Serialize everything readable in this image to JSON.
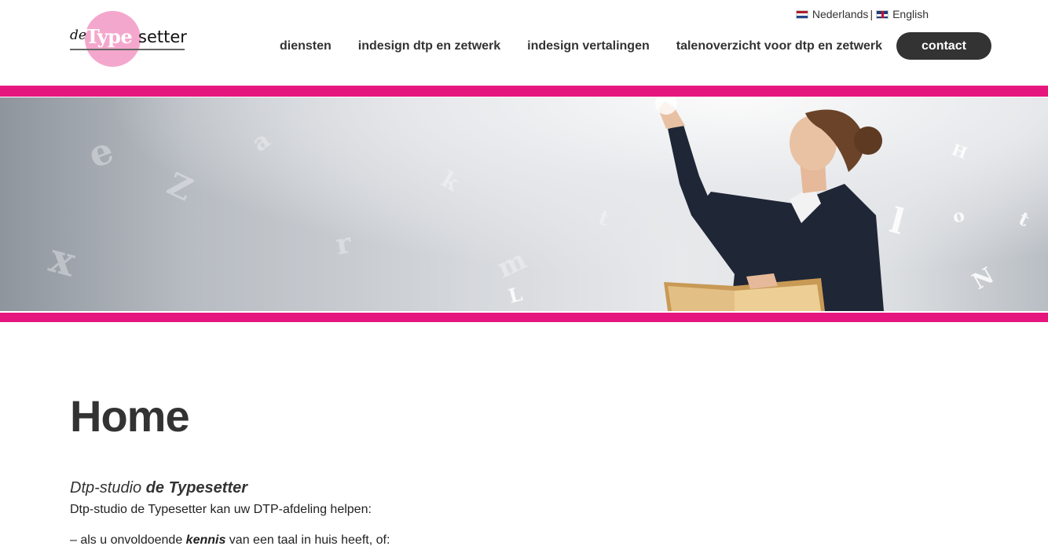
{
  "logo": {
    "de": "de",
    "type": "Type",
    "setter": "setter"
  },
  "languages": [
    {
      "label": "Nederlands",
      "flag": "flag-nl-icon"
    },
    {
      "label": "English",
      "flag": "flag-uk-icon"
    }
  ],
  "language_separator": "|",
  "nav": {
    "items": [
      "diensten",
      "indesign dtp en zetwerk",
      "indesign vertalingen",
      "talenoverzicht voor dtp en zetwerk"
    ],
    "contact": "contact"
  },
  "colors": {
    "accent": "#e5177e",
    "logo_circle": "#f4a7cc",
    "dark": "#333333"
  },
  "main": {
    "title": "Home",
    "subheading_prefix": "Dtp-studio ",
    "subheading_bold": "de Typesetter",
    "intro": "Dtp-studio de Typesetter kan uw DTP-afdeling helpen:",
    "bullet_prefix": "– als u onvoldoende ",
    "bullet_emphasis": "kennis",
    "bullet_suffix": " van een taal in huis heeft, of:"
  }
}
